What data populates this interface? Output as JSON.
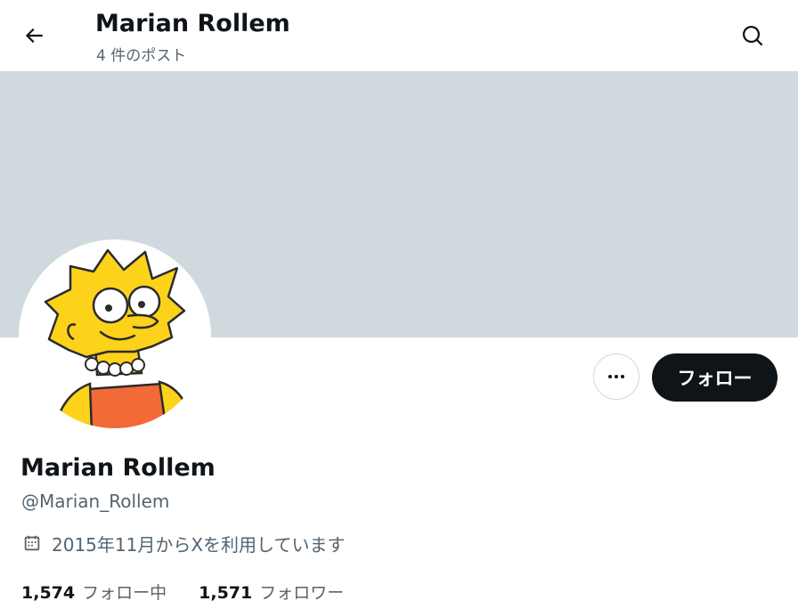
{
  "header": {
    "title": "Marian Rollem",
    "post_count": "4 件のポスト"
  },
  "profile": {
    "display_name": "Marian Rollem",
    "handle": "@Marian_Rollem",
    "joined": "2015年11月からXを利用しています",
    "following_count": "1,574",
    "following_label": "フォロー中",
    "followers_count": "1,571",
    "followers_label": "フォロワー"
  },
  "actions": {
    "follow_label": "フォロー"
  },
  "icons": {
    "back": "arrow-left-icon",
    "search": "search-icon",
    "more": "more-dots-icon",
    "calendar": "calendar-icon"
  },
  "colors": {
    "banner": "#cfd9de",
    "text_primary": "#0f1419",
    "text_secondary": "#536471",
    "follow_button_bg": "#0f1419",
    "follow_button_text": "#ffffff"
  }
}
